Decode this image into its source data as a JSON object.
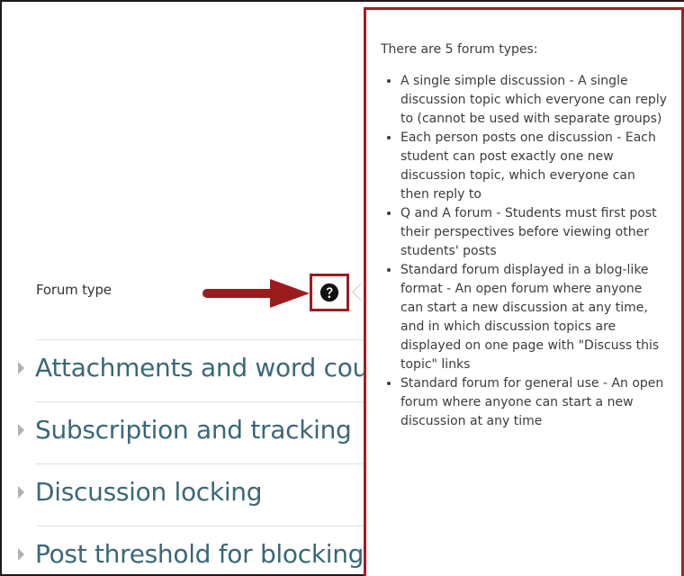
{
  "field": {
    "label": "Forum type",
    "help_icon": "question-circle-icon"
  },
  "sections": [
    {
      "title": "Attachments and word count",
      "icon": "chevron-right-icon"
    },
    {
      "title": "Subscription and tracking",
      "icon": "chevron-right-icon"
    },
    {
      "title": "Discussion locking",
      "icon": "chevron-right-icon"
    },
    {
      "title": "Post threshold for blocking",
      "icon": "chevron-right-icon"
    }
  ],
  "popover": {
    "intro": "There are 5 forum types:",
    "items": [
      "A single simple discussion - A single discussion topic which everyone can reply to (cannot be used with separate groups)",
      "Each person posts one discussion - Each student can post exactly one new discussion topic, which everyone can then reply to",
      "Q and A forum - Students must first post their perspectives before viewing other students' posts",
      "Standard forum displayed in a blog-like format - An open forum where anyone can start a new discussion at any time, and in which discussion topics are displayed on one page with \"Discuss this topic\" links",
      "Standard forum for general use - An open forum where anyone can start a new discussion at any time"
    ]
  },
  "colors": {
    "annotation_red": "#9b1c1c",
    "section_title": "#3a6878"
  }
}
